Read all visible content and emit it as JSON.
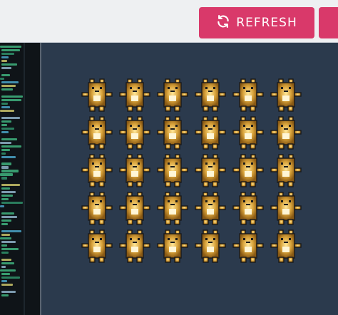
{
  "toolbar": {
    "refresh_label": "REFRESH",
    "refresh_icon": "refresh-icon",
    "accent_color": "#d9396a"
  },
  "editor": {
    "background": "#0f1418"
  },
  "canvas": {
    "background": "#2b3a4d",
    "sprite": "pixel-creature",
    "rows": 5,
    "columns": 6,
    "sprite_color": "#c58d2a"
  }
}
